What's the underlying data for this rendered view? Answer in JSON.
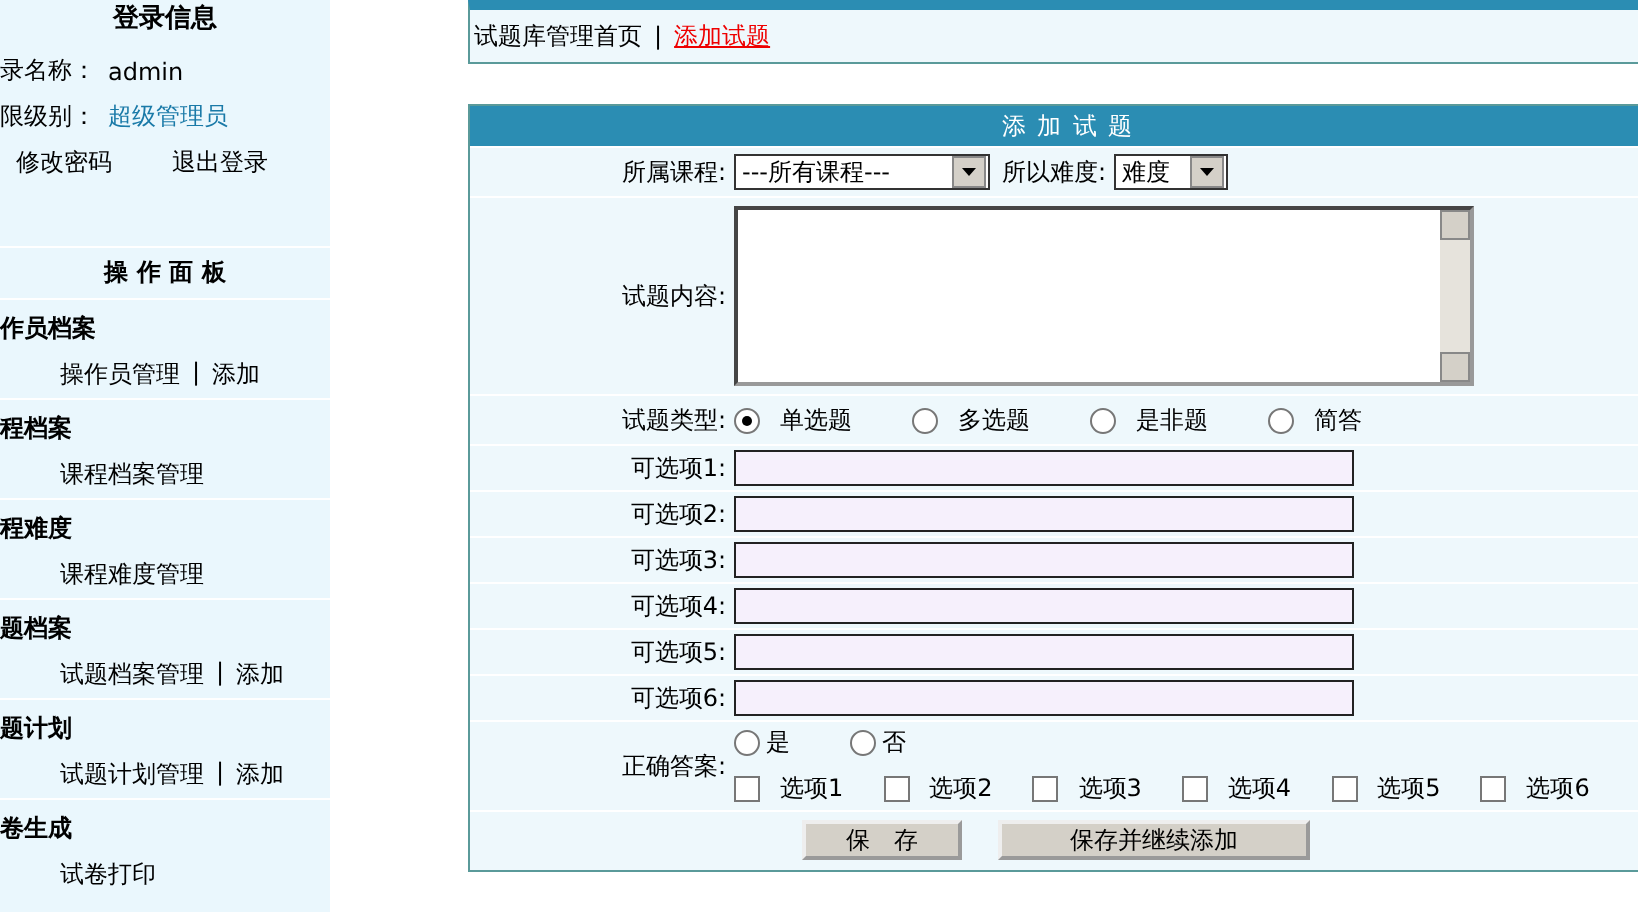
{
  "sidebar": {
    "login": {
      "title": "登录信息",
      "user_label": "录名称：",
      "user_value": "admin",
      "level_label": "限级别：",
      "level_value": "超级管理员",
      "links": [
        "修改密码",
        "退出登录"
      ]
    },
    "panel_title": "操 作 面 板",
    "sections": [
      {
        "title": "作员档案",
        "links": [
          "操作员管理",
          "添加"
        ],
        "separator": "|"
      },
      {
        "title": "程档案",
        "links": [
          "课程档案管理"
        ]
      },
      {
        "title": "程难度",
        "links": [
          "课程难度管理"
        ]
      },
      {
        "title": "题档案",
        "links": [
          "试题档案管理",
          "添加"
        ],
        "separator": "|"
      },
      {
        "title": "题计划",
        "links": [
          "试题计划管理",
          "添加"
        ],
        "separator": "|"
      },
      {
        "title": "卷生成",
        "links": [
          "试卷打印"
        ]
      }
    ]
  },
  "breadcrumb_separator": "|",
  "breadcrumb": [
    {
      "label": "试题库管理首页",
      "selected": false
    },
    {
      "label": "添加试题",
      "selected": true
    }
  ],
  "form": {
    "title": "添 加 试 题",
    "course_label": "所属课程:",
    "course_value": "---所有课程---",
    "difficulty_label": "所以难度:",
    "difficulty_value": "难度",
    "content_label": "试题内容:",
    "type_label": "试题类型:",
    "types": [
      {
        "label": "单选题",
        "selected": true
      },
      {
        "label": "多选题",
        "selected": false
      },
      {
        "label": "是非题",
        "selected": false
      },
      {
        "label": "简答",
        "selected": false
      }
    ],
    "options": [
      "可选项1:",
      "可选项2:",
      "可选项3:",
      "可选项4:",
      "可选项5:",
      "可选项6:"
    ],
    "answer_label": "正确答案:",
    "answer_radios": [
      {
        "label": "是",
        "selected": false
      },
      {
        "label": "否",
        "selected": false
      }
    ],
    "answer_checks": [
      {
        "label": "选项1",
        "checked": false
      },
      {
        "label": "选项2",
        "checked": false
      },
      {
        "label": "选项3",
        "checked": false
      },
      {
        "label": "选项4",
        "checked": false
      },
      {
        "label": "选项5",
        "checked": false
      },
      {
        "label": "选项6",
        "checked": false
      }
    ],
    "buttons": [
      "保　存",
      "保存并继续添加"
    ]
  }
}
